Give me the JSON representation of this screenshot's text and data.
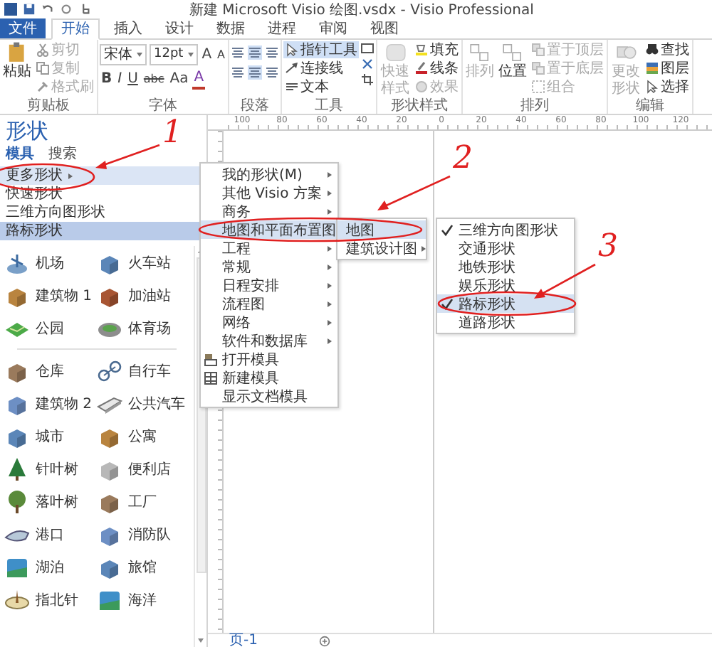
{
  "window": {
    "title": "新建 Microsoft Visio 绘图.vsdx - Visio Professional"
  },
  "ribbon_tabs": [
    {
      "label": "文件",
      "kind": "file",
      "selected": false
    },
    {
      "label": "开始",
      "kind": "tab",
      "selected": true
    },
    {
      "label": "插入",
      "kind": "tab",
      "selected": false
    },
    {
      "label": "设计",
      "kind": "tab",
      "selected": false
    },
    {
      "label": "数据",
      "kind": "tab",
      "selected": false
    },
    {
      "label": "进程",
      "kind": "tab",
      "selected": false
    },
    {
      "label": "审阅",
      "kind": "tab",
      "selected": false
    },
    {
      "label": "视图",
      "kind": "tab",
      "selected": false
    }
  ],
  "ribbon_groups": [
    {
      "kind": "clipboard",
      "label": "剪贴板",
      "buttons": [
        {
          "label": "粘贴",
          "kind": "large",
          "disabled": false
        },
        {
          "label": "剪切",
          "kind": "small",
          "disabled": true
        },
        {
          "label": "复制",
          "kind": "small",
          "disabled": true
        },
        {
          "label": "格式刷",
          "kind": "small",
          "disabled": true
        }
      ]
    },
    {
      "kind": "font",
      "label": "字体",
      "font_name": "宋体",
      "font_size": "12pt",
      "grow": "A",
      "shrink": "A",
      "styles": [
        "B",
        "I",
        "U",
        "abc",
        "Aa"
      ],
      "font_color": "A"
    },
    {
      "kind": "paragraph",
      "label": "段落"
    },
    {
      "kind": "tools",
      "label": "工具",
      "buttons": [
        {
          "label": "指针工具",
          "kind": "small",
          "selected": true
        },
        {
          "label": "连接线",
          "kind": "small",
          "selected": false
        },
        {
          "label": "文本",
          "kind": "small",
          "selected": false
        }
      ]
    },
    {
      "kind": "shape_styles",
      "label": "形状样式",
      "buttons": [
        {
          "label": "快速样式",
          "kind": "large",
          "disabled": true
        },
        {
          "label": "填充",
          "kind": "small",
          "disabled": false
        },
        {
          "label": "线条",
          "kind": "small",
          "disabled": false
        },
        {
          "label": "效果",
          "kind": "small",
          "disabled": true
        }
      ]
    },
    {
      "kind": "arrange",
      "label": "排列",
      "buttons": [
        {
          "label": "排列",
          "kind": "large",
          "disabled": true
        },
        {
          "label": "位置",
          "kind": "large",
          "disabled": false
        },
        {
          "label": "置于顶层",
          "kind": "small",
          "disabled": true
        },
        {
          "label": "置于底层",
          "kind": "small",
          "disabled": true
        },
        {
          "label": "组合",
          "kind": "small",
          "disabled": true
        }
      ]
    },
    {
      "kind": "editing",
      "label": "编辑",
      "buttons": [
        {
          "label": "更改形状",
          "kind": "large",
          "disabled": true
        },
        {
          "label": "查找",
          "kind": "small",
          "disabled": false
        },
        {
          "label": "图层",
          "kind": "small",
          "disabled": false
        },
        {
          "label": "选择",
          "kind": "small",
          "disabled": false
        }
      ]
    }
  ],
  "shapes_panel": {
    "title": "形状",
    "tabs": [
      {
        "label": "模具",
        "selected": true
      },
      {
        "label": "搜索",
        "selected": false
      }
    ],
    "stencils": [
      {
        "label": "更多形状",
        "kind": "more",
        "selected": false,
        "highlighted": true
      },
      {
        "label": "快速形状",
        "kind": "stencil",
        "selected": false,
        "highlighted": false
      },
      {
        "label": "三维方向图形状",
        "kind": "stencil",
        "selected": false,
        "highlighted": false
      },
      {
        "label": "路标形状",
        "kind": "stencil",
        "selected": true,
        "highlighted": false
      }
    ],
    "sections": [
      {
        "shapes": [
          "机场",
          "火车站",
          "建筑物 1",
          "加油站",
          "公园",
          "体育场"
        ]
      },
      {
        "shapes": [
          "仓库",
          "自行车",
          "建筑物 2",
          "公共汽车",
          "城市",
          "公寓",
          "针叶树",
          "便利店",
          "落叶树",
          "工厂",
          "港口",
          "消防队",
          "湖泊",
          "旅馆",
          "指北针",
          "海洋"
        ]
      }
    ]
  },
  "ruler": {
    "labels": [
      "100",
      "80",
      "60",
      "40",
      "20",
      "0",
      "20",
      "40",
      "60",
      "80",
      "100",
      "120"
    ]
  },
  "page_tabs": [
    {
      "label": "页-1",
      "selected": true
    }
  ],
  "menu": [
    {
      "label": "我的形状(M)",
      "kind": "submenu",
      "selected": false
    },
    {
      "label": "其他 Visio 方案",
      "kind": "submenu",
      "selected": false
    },
    {
      "label": "商务",
      "kind": "submenu",
      "selected": false
    },
    {
      "label": "地图和平面布置图",
      "kind": "submenu",
      "selected": true
    },
    {
      "label": "工程",
      "kind": "submenu",
      "selected": false
    },
    {
      "label": "常规",
      "kind": "submenu",
      "selected": false
    },
    {
      "label": "日程安排",
      "kind": "submenu",
      "selected": false
    },
    {
      "label": "流程图",
      "kind": "submenu",
      "selected": false
    },
    {
      "label": "网络",
      "kind": "submenu",
      "selected": false
    },
    {
      "label": "软件和数据库",
      "kind": "submenu",
      "selected": false
    },
    {
      "label": "打开模具",
      "kind": "open",
      "selected": false
    },
    {
      "label": "新建模具",
      "kind": "new",
      "selected": false
    },
    {
      "label": "显示文档模具",
      "kind": "plain",
      "selected": false
    }
  ],
  "submenu": [
    {
      "label": "地图",
      "kind": "plain",
      "selected": true
    },
    {
      "label": "建筑设计图",
      "kind": "submenu",
      "selected": false
    }
  ],
  "stencil_menu": [
    {
      "label": "三维方向图形状",
      "checked": true,
      "selected": false
    },
    {
      "label": "交通形状",
      "checked": false,
      "selected": false
    },
    {
      "label": "地铁形状",
      "checked": false,
      "selected": false
    },
    {
      "label": "娱乐形状",
      "checked": false,
      "selected": false
    },
    {
      "label": "路标形状",
      "checked": true,
      "selected": true
    },
    {
      "label": "道路形状",
      "checked": false,
      "selected": false
    }
  ],
  "annotations": [
    {
      "number": "1"
    },
    {
      "number": "2"
    },
    {
      "number": "3"
    }
  ]
}
